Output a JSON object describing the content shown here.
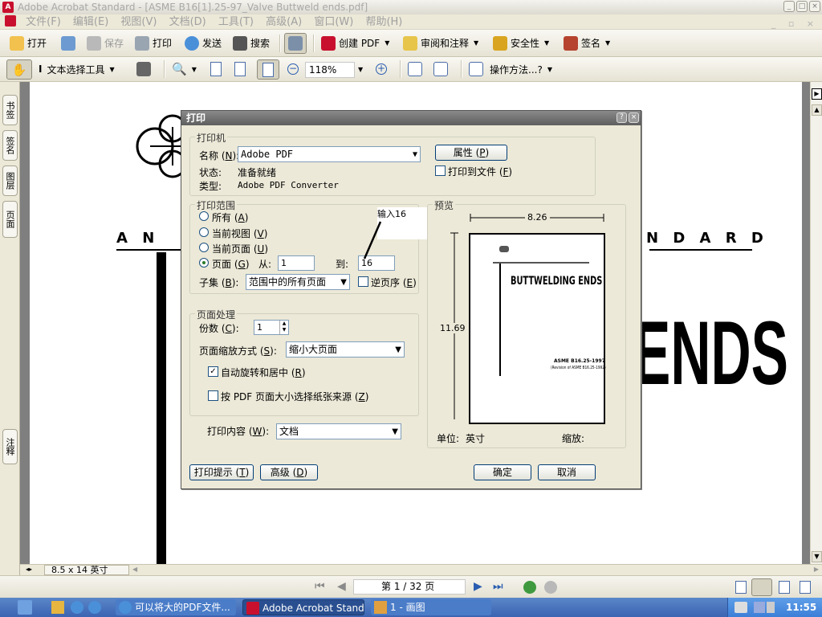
{
  "window": {
    "title": "Adobe Acrobat Standard - [ASME B16[1].25-97_Valve Buttweld ends.pdf]"
  },
  "menu": [
    "文件(F)",
    "编辑(E)",
    "视图(V)",
    "文档(D)",
    "工具(T)",
    "高级(A)",
    "窗口(W)",
    "帮助(H)"
  ],
  "toolbar1": {
    "open": "打开",
    "save": "保存",
    "print": "打印",
    "send": "发送",
    "search": "搜索",
    "create_pdf": "创建 PDF",
    "review": "审阅和注释",
    "security": "安全性",
    "sign": "签名"
  },
  "toolbar2": {
    "select_text": "文本选择工具",
    "zoom": "118%",
    "how_to": "操作方法...?"
  },
  "left_tabs": [
    "书签",
    "签名",
    "图层",
    "页面",
    "注释"
  ],
  "page_bg": {
    "left_text": "A N",
    "right_text": "N D A R D",
    "big_text": "ENDS"
  },
  "dialog": {
    "title": "打印",
    "printer": {
      "group": "打印机",
      "name_label": "名称",
      "name_value": "Adobe PDF",
      "status_label": "状态:",
      "status_value": "准备就绪",
      "type_label": "类型:",
      "type_value": "Adobe PDF Converter",
      "properties": "属性",
      "print_to_file": "打印到文件"
    },
    "range": {
      "group": "打印范围",
      "all": "所有",
      "current_view": "当前视图",
      "current_page": "当前页面",
      "pages": "页面",
      "from_label": "从:",
      "from_value": "1",
      "to_label": "到:",
      "to_value": "16",
      "annotation": "输入16",
      "subset_label": "子集",
      "subset_value": "范围中的所有页面",
      "reverse": "逆页序"
    },
    "handling": {
      "group": "页面处理",
      "copies_label": "份数",
      "copies_value": "1",
      "scaling_label": "页面缩放方式",
      "scaling_value": "缩小大页面",
      "auto_rotate": "自动旋转和居中",
      "choose_paper": "按 PDF 页面大小选择纸张来源"
    },
    "content_label": "打印内容",
    "content_value": "文档",
    "preview": {
      "group": "预览",
      "width": "8.26",
      "height": "11.69",
      "unit_label": "单位:",
      "unit_value": "英寸",
      "zoom_label": "缩放:",
      "thumb_title": "BUTTWELDING ENDS",
      "thumb_line1": "ASME B16.25-1997",
      "thumb_line2": "(Revision of ASME B16.25-1992)"
    },
    "tips": "打印提示",
    "advanced": "高级",
    "ok": "确定",
    "cancel": "取消"
  },
  "statusbar": {
    "page_size": "8.5 x 14 英寸",
    "page_nav": "第 1 / 32 页"
  },
  "taskbar": {
    "task1": "可以将大的PDF文件...",
    "task2": "Adobe Acrobat Stand...",
    "task3": "1 - 画图",
    "clock": "11:55"
  },
  "colors": {
    "accent": "#3b64b2",
    "pdf_red": "#c8102e",
    "dialog_bg": "#ece9d8"
  }
}
